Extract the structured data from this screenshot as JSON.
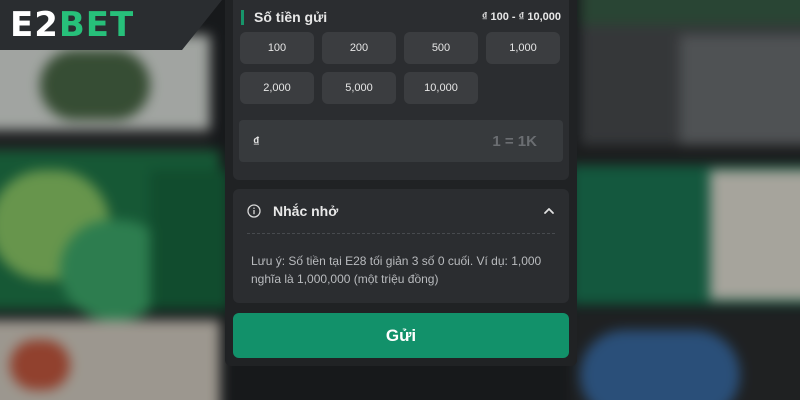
{
  "brand": {
    "logo_left": "E2",
    "logo_right": "BET",
    "accent_color": "#12916a"
  },
  "amount": {
    "title": "Số tiền gửi",
    "range": "₫ 100 - ₫ 10,000",
    "presets": [
      "100",
      "200",
      "500",
      "1,000",
      "2,000",
      "5,000",
      "10,000"
    ],
    "currency_symbol": "₫",
    "input_value": "",
    "unit_hint": "1 = 1K"
  },
  "reminder": {
    "title": "Nhắc nhở",
    "icon": "info-icon",
    "expanded": true,
    "text": "Lưu ý: Số tiền tại E28 tối giản 3 số 0 cuối. Ví dụ: 1,000 nghĩa là 1,000,000 (một triệu đồng)"
  },
  "submit": {
    "label": "Gửi"
  }
}
